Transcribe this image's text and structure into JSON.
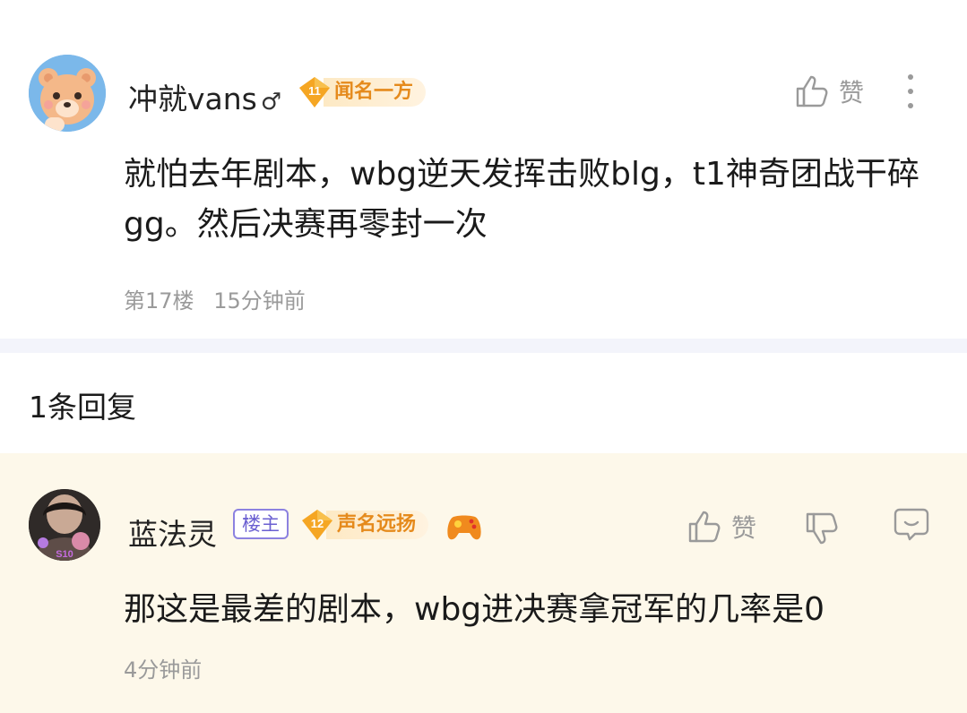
{
  "post": {
    "username": "冲就vans",
    "gender_symbol": "♂",
    "level": "11",
    "level_title": "闻名一方",
    "like_label": "赞",
    "content": "就怕去年剧本，wbg逆天发挥击败blg，t1神奇团战干碎gg。然后决赛再零封一次",
    "floor": "第17楼",
    "time": "15分钟前",
    "avatar_icon": "bear-avatar",
    "more_icon": "more-vertical-icon"
  },
  "replies_header": {
    "count_label": "1条回复"
  },
  "reply": {
    "username": "蓝法灵",
    "owner_tag": "楼主",
    "level": "12",
    "level_title": "声名远扬",
    "like_label": "赞",
    "content": "那这是最差的剧本，wbg进决赛拿冠军的几率是0",
    "time": "4分钟前",
    "avatar_label": "S10",
    "icons": [
      "game-controller-icon",
      "thumbs-up-icon",
      "thumbs-down-icon",
      "comment-icon"
    ]
  },
  "colors": {
    "badge_orange": "#e58a1c",
    "badge_bg": "#fde9c4",
    "owner_tag": "#6a5fd1",
    "reply_bg": "#fdf8ea",
    "meta_gray": "#9a9a9a"
  }
}
